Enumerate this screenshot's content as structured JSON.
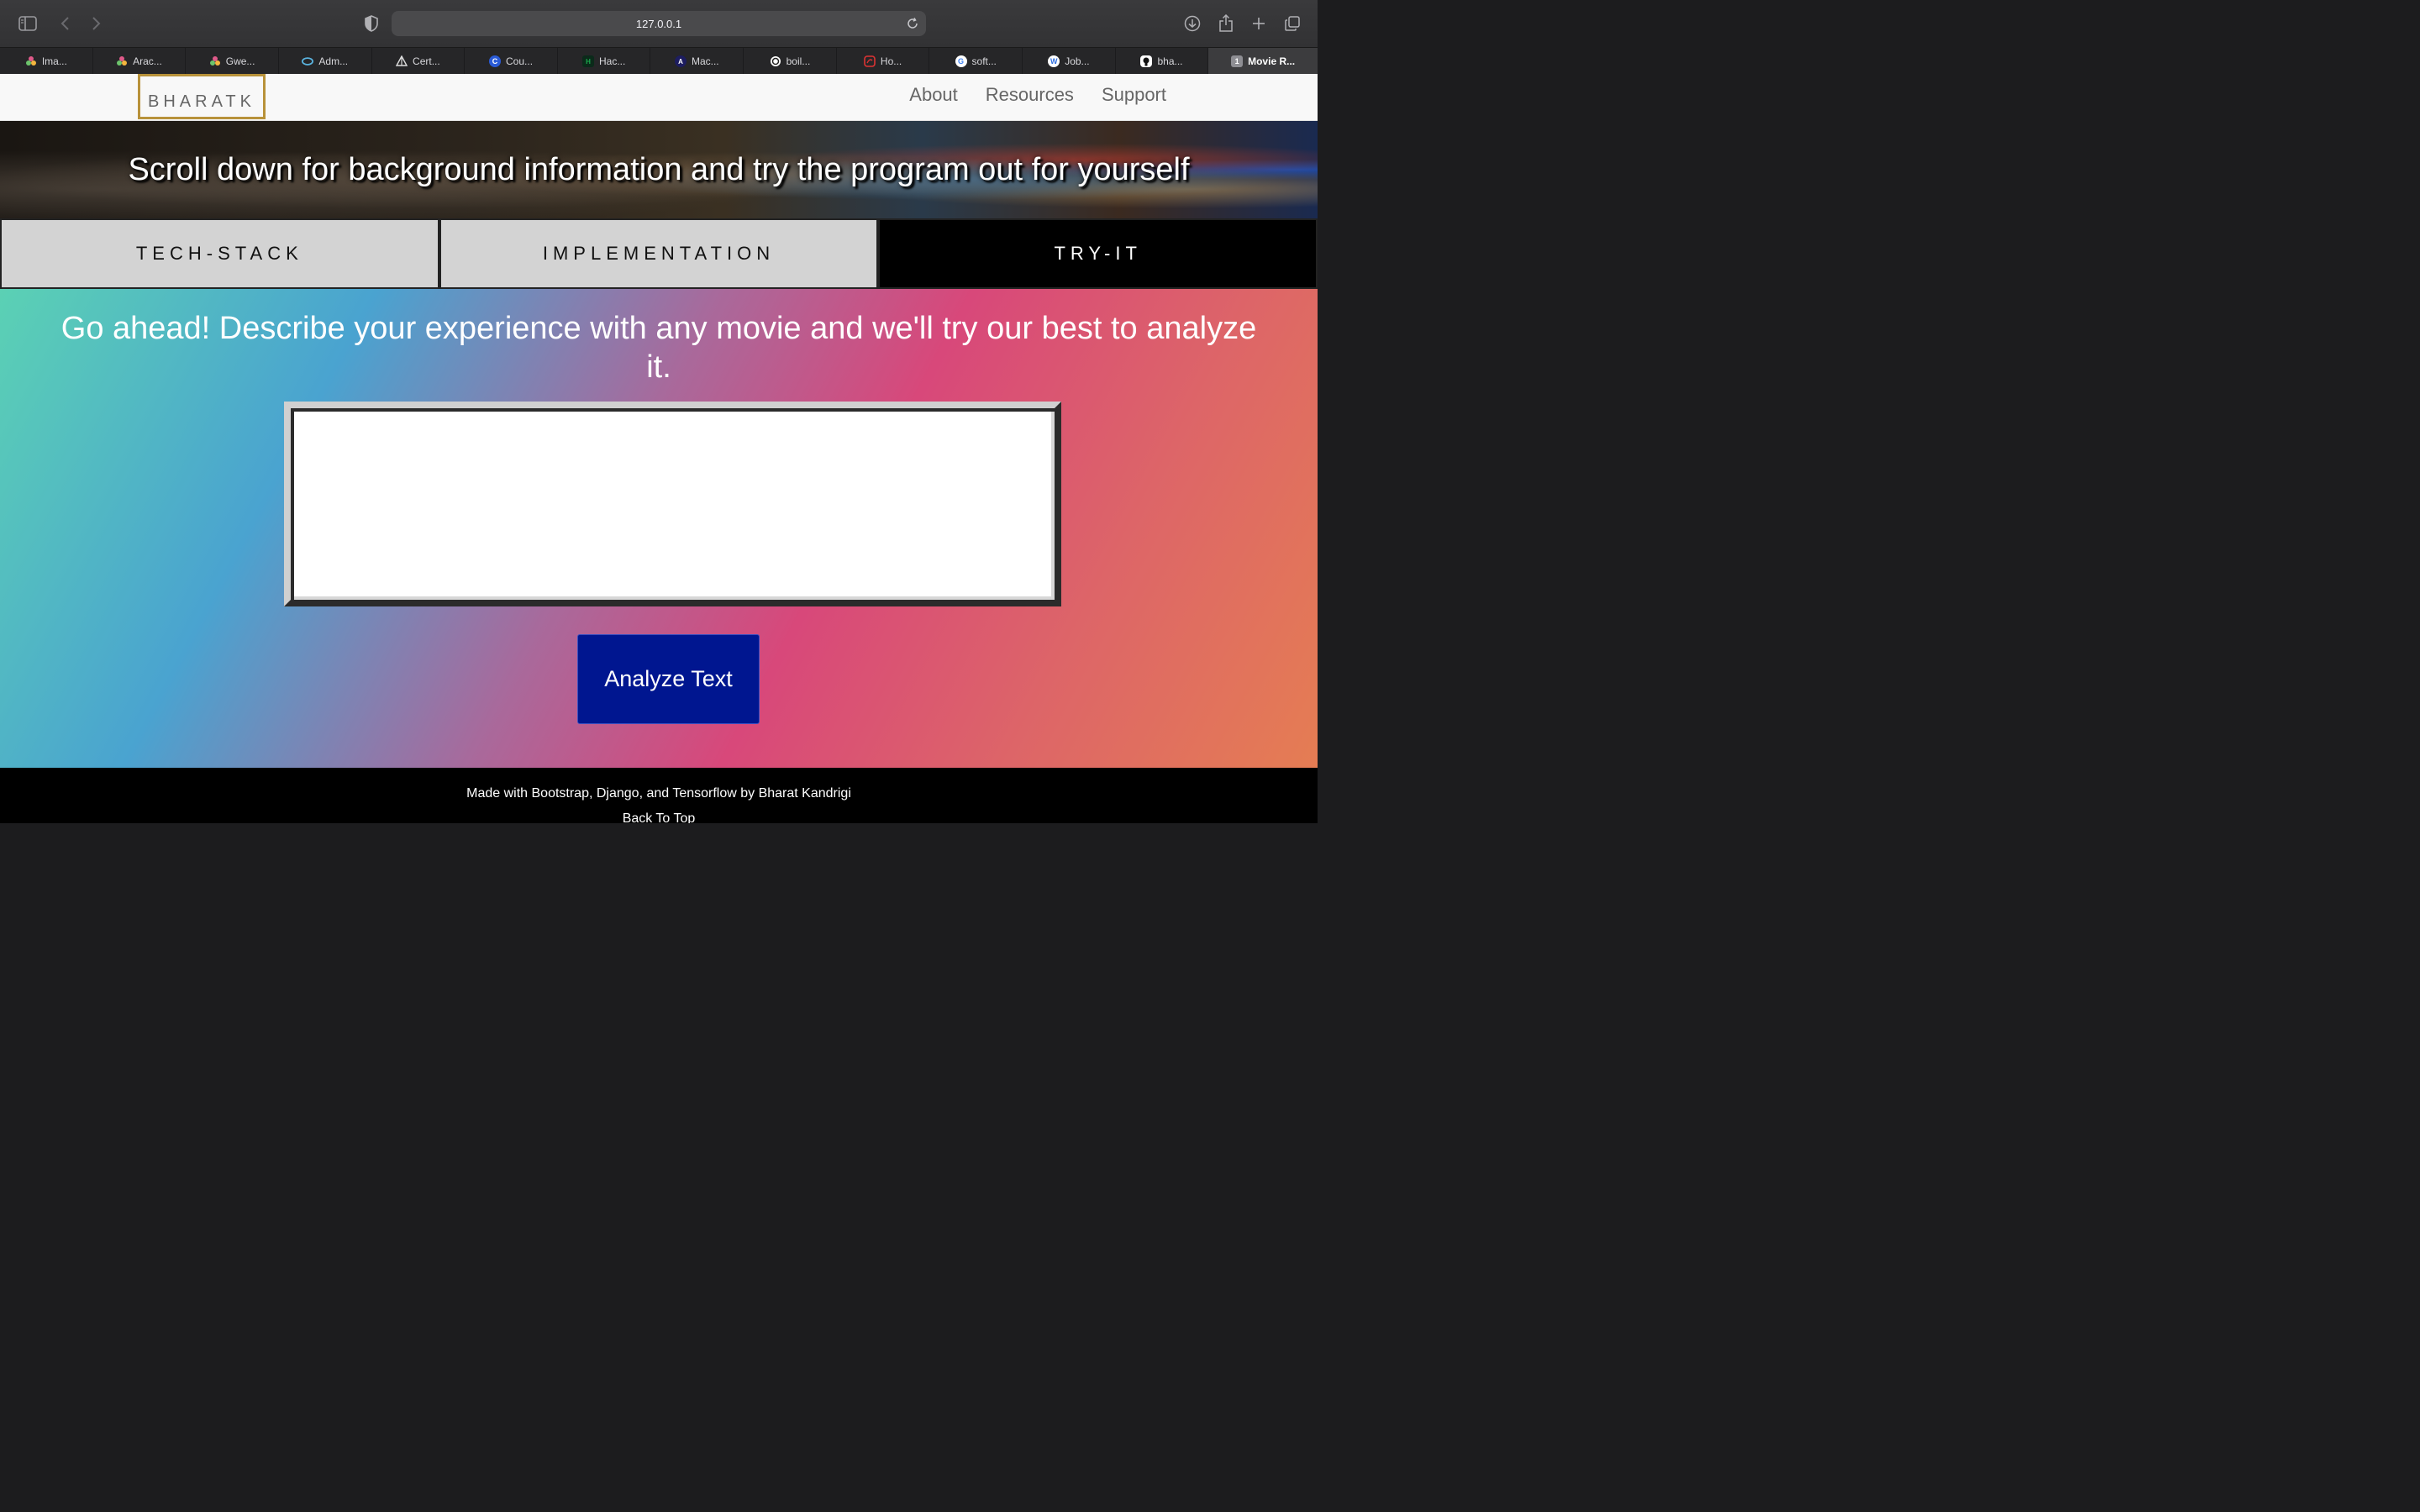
{
  "browser": {
    "url": "127.0.0.1",
    "tabs": [
      {
        "label": "Ima...",
        "icon": "multicolor-dots-icon",
        "color": "#e05a8a"
      },
      {
        "label": "Arac...",
        "icon": "multicolor-dots-icon",
        "color": "#e05a8a"
      },
      {
        "label": "Gwe...",
        "icon": "multicolor-dots-icon",
        "color": "#e05a8a"
      },
      {
        "label": "Adm...",
        "icon": "eye-icon",
        "color": "#5ab4e0"
      },
      {
        "label": "Cert...",
        "icon": "pyramid-icon",
        "color": "#dddddd"
      },
      {
        "label": "Cou...",
        "icon": "c-letter-icon",
        "color": "#2a5bd7"
      },
      {
        "label": "Hac...",
        "icon": "hackerrank-icon",
        "color": "#1ba94c"
      },
      {
        "label": "Mac...",
        "icon": "a-letter-icon",
        "color": "#1d1d60"
      },
      {
        "label": "boil...",
        "icon": "spiral-icon",
        "color": "#ffffff"
      },
      {
        "label": "Ho...",
        "icon": "square-logo-icon",
        "color": "#d33"
      },
      {
        "label": "soft...",
        "icon": "google-icon",
        "color": "#ffffff"
      },
      {
        "label": "Job...",
        "icon": "w-letter-icon",
        "color": "#2f6fe0"
      },
      {
        "label": "bha...",
        "icon": "github-icon",
        "color": "#ffffff"
      },
      {
        "label": "Movie R...",
        "icon": "number-badge-icon",
        "badge": "1",
        "color": "#8e8e93"
      }
    ]
  },
  "navbar": {
    "brand": "BHARATK",
    "links": [
      "About",
      "Resources",
      "Support"
    ],
    "brand_border_color": "#b8923a"
  },
  "hero": {
    "text": "Scroll down for background information and try the program out for yourself"
  },
  "section_tabs": [
    {
      "label": "TECH-STACK",
      "active": false
    },
    {
      "label": "IMPLEMENTATION",
      "active": false
    },
    {
      "label": "TRY-IT",
      "active": true
    }
  ],
  "tryit": {
    "prompt": "Go ahead! Describe your experience with any movie and we'll try our best to analyze it.",
    "textarea_value": "",
    "button_label": "Analyze Text",
    "button_color": "#001690"
  },
  "footer": {
    "credit": "Made with Bootstrap, Django, and Tensorflow by Bharat Kandrigi",
    "back_to_top": "Back To Top"
  }
}
